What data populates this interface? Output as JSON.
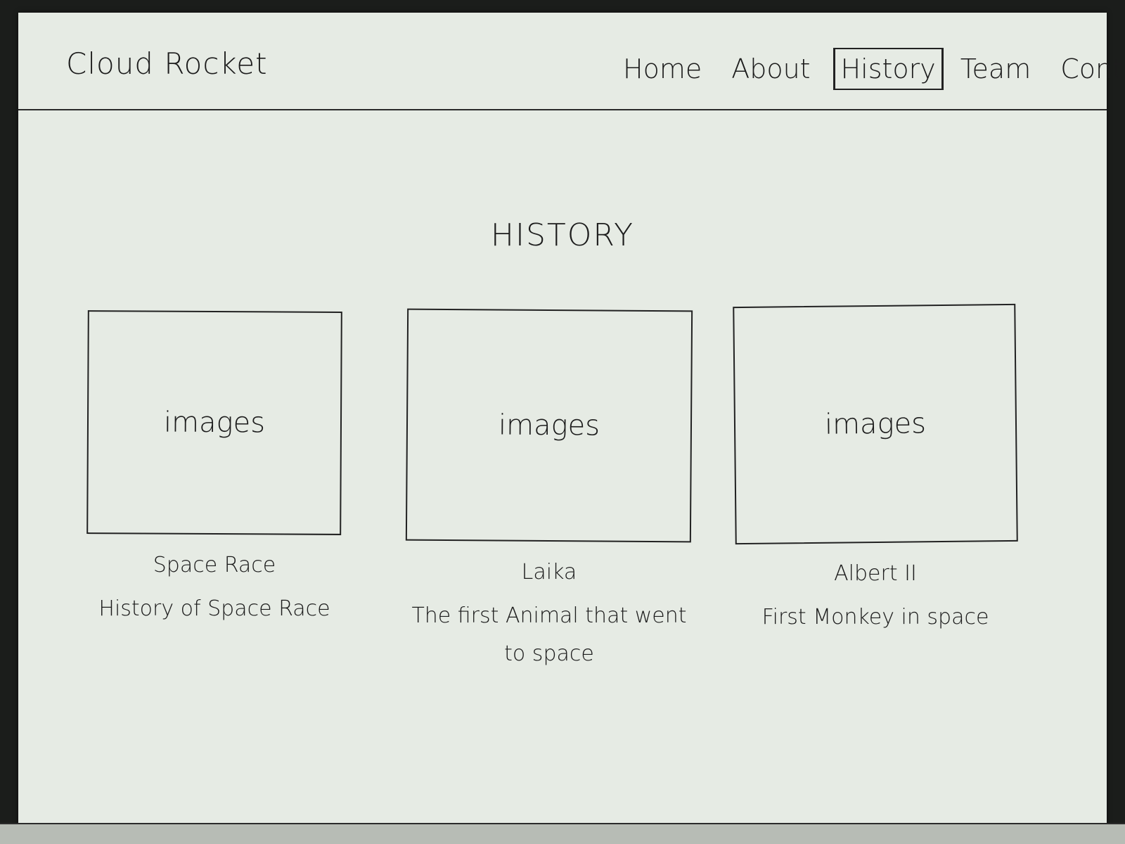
{
  "header": {
    "brand": "Cloud Rocket",
    "nav": [
      {
        "label": "Home"
      },
      {
        "label": "About"
      },
      {
        "label": "History",
        "active": true
      },
      {
        "label": "Team"
      },
      {
        "label": "Contact"
      }
    ]
  },
  "main": {
    "title": "HISTORY",
    "cards": [
      {
        "image_placeholder": "images",
        "title": "Space Race",
        "description": "History of Space Race"
      },
      {
        "image_placeholder": "images",
        "title": "Laika",
        "description": "The first Animal that went to space"
      },
      {
        "image_placeholder": "images",
        "title": "Albert II",
        "description": "First Monkey in space"
      }
    ]
  },
  "colors": {
    "paper": "#e6ebe4",
    "ink": "#1c1c1c",
    "background": "#1b1d1b"
  }
}
